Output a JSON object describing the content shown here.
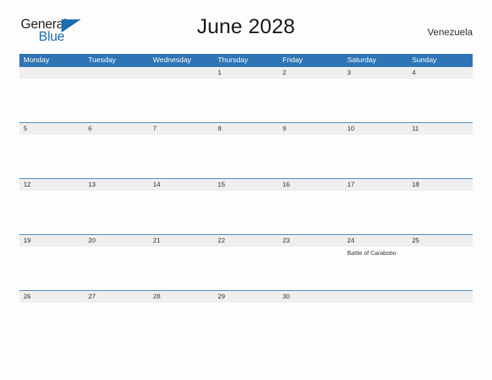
{
  "logo": {
    "text_primary": "General",
    "text_secondary": "Blue",
    "flag_icon": "blue-triangle-flag-icon",
    "primary_color": "#231f20",
    "secondary_color": "#1b6cb0"
  },
  "header": {
    "title": "June 2028",
    "region": "Venezuela"
  },
  "theme": {
    "header_blue": "#2f74b5",
    "row_band_gray": "#efefef",
    "page_background": "#fdfdfd",
    "text_color": "#2b2b2b"
  },
  "calendar": {
    "month": "June",
    "year": "2028",
    "weekday_headers": [
      "Monday",
      "Tuesday",
      "Wednesday",
      "Thursday",
      "Friday",
      "Saturday",
      "Sunday"
    ],
    "weeks": [
      {
        "days": [
          {
            "number": "",
            "events": []
          },
          {
            "number": "",
            "events": []
          },
          {
            "number": "",
            "events": []
          },
          {
            "number": "1",
            "events": []
          },
          {
            "number": "2",
            "events": []
          },
          {
            "number": "3",
            "events": []
          },
          {
            "number": "4",
            "events": []
          }
        ]
      },
      {
        "days": [
          {
            "number": "5",
            "events": []
          },
          {
            "number": "6",
            "events": []
          },
          {
            "number": "7",
            "events": []
          },
          {
            "number": "8",
            "events": []
          },
          {
            "number": "9",
            "events": []
          },
          {
            "number": "10",
            "events": []
          },
          {
            "number": "11",
            "events": []
          }
        ]
      },
      {
        "days": [
          {
            "number": "12",
            "events": []
          },
          {
            "number": "13",
            "events": []
          },
          {
            "number": "14",
            "events": []
          },
          {
            "number": "15",
            "events": []
          },
          {
            "number": "16",
            "events": []
          },
          {
            "number": "17",
            "events": []
          },
          {
            "number": "18",
            "events": []
          }
        ]
      },
      {
        "days": [
          {
            "number": "19",
            "events": []
          },
          {
            "number": "20",
            "events": []
          },
          {
            "number": "21",
            "events": []
          },
          {
            "number": "22",
            "events": []
          },
          {
            "number": "23",
            "events": []
          },
          {
            "number": "24",
            "events": [
              "Battle of Carabobo"
            ]
          },
          {
            "number": "25",
            "events": []
          }
        ]
      },
      {
        "days": [
          {
            "number": "26",
            "events": []
          },
          {
            "number": "27",
            "events": []
          },
          {
            "number": "28",
            "events": []
          },
          {
            "number": "29",
            "events": []
          },
          {
            "number": "30",
            "events": []
          },
          {
            "number": "",
            "events": []
          },
          {
            "number": "",
            "events": []
          }
        ]
      }
    ]
  }
}
